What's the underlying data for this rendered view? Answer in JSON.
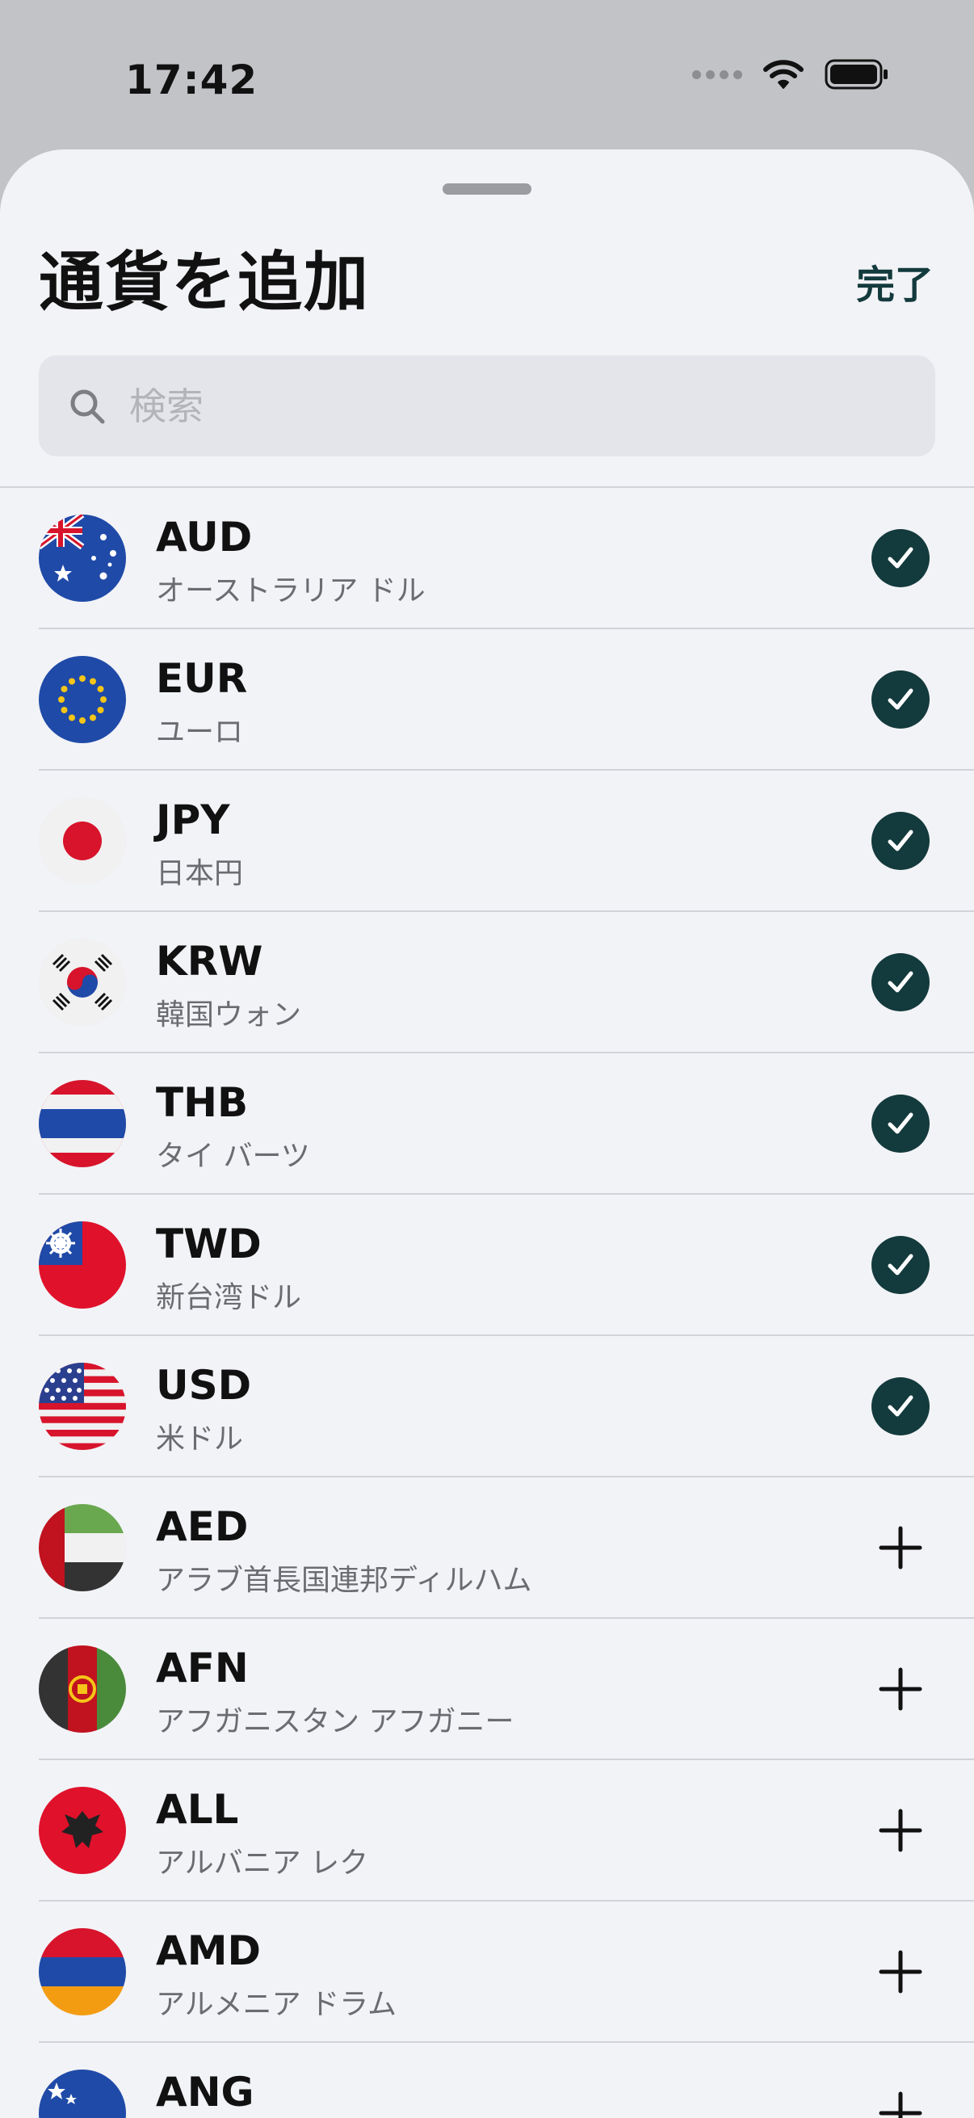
{
  "status_bar": {
    "time": "17:42"
  },
  "sheet": {
    "title": "通貨を追加",
    "done_label": "完了",
    "search": {
      "placeholder": "検索",
      "value": ""
    }
  },
  "colors": {
    "accent": "#133a3c",
    "sheet_bg": "#f2f3f7",
    "secondary_text": "#6b6c71"
  },
  "currencies": [
    {
      "code": "AUD",
      "name": "オーストラリア ドル",
      "flag": "australia-flag",
      "added": true
    },
    {
      "code": "EUR",
      "name": "ユーロ",
      "flag": "eu-flag",
      "added": true
    },
    {
      "code": "JPY",
      "name": "日本円",
      "flag": "japan-flag",
      "added": true
    },
    {
      "code": "KRW",
      "name": "韓国ウォン",
      "flag": "south-korea-flag",
      "added": true
    },
    {
      "code": "THB",
      "name": "タイ バーツ",
      "flag": "thailand-flag",
      "added": true
    },
    {
      "code": "TWD",
      "name": "新台湾ドル",
      "flag": "taiwan-flag",
      "added": true
    },
    {
      "code": "USD",
      "name": "米ドル",
      "flag": "usa-flag",
      "added": true
    },
    {
      "code": "AED",
      "name": "アラブ首長国連邦ディルハム",
      "flag": "uae-flag",
      "added": false
    },
    {
      "code": "AFN",
      "name": "アフガニスタン アフガニー",
      "flag": "afghanistan-flag",
      "added": false
    },
    {
      "code": "ALL",
      "name": "アルバニア レク",
      "flag": "albania-flag",
      "added": false
    },
    {
      "code": "AMD",
      "name": "アルメニア ドラム",
      "flag": "armenia-flag",
      "added": false
    },
    {
      "code": "ANG",
      "name": "",
      "flag": "curacao-flag",
      "added": false
    }
  ]
}
